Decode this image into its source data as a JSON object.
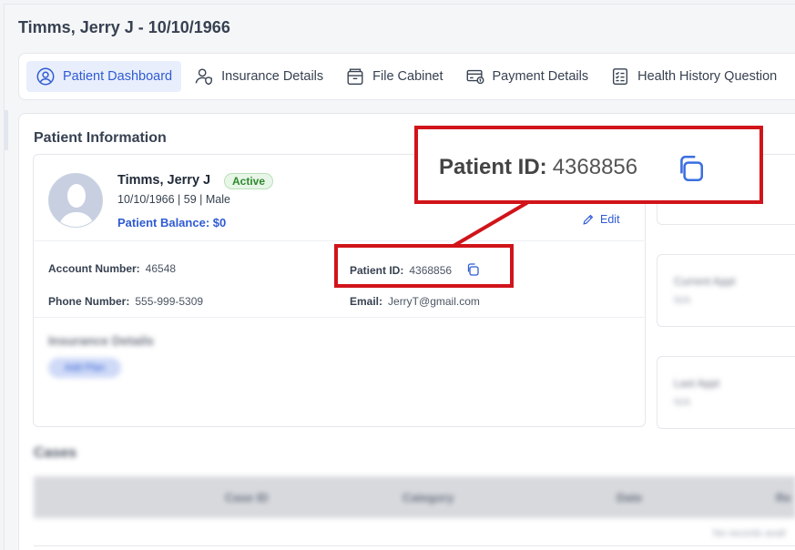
{
  "page": {
    "title": "Timms, Jerry J - 10/10/1966"
  },
  "tabs": [
    {
      "label": "Patient Dashboard",
      "icon": "user-circle-icon",
      "active": true
    },
    {
      "label": "Insurance Details",
      "icon": "user-shield-icon",
      "active": false
    },
    {
      "label": "File Cabinet",
      "icon": "file-cabinet-icon",
      "active": false
    },
    {
      "label": "Payment Details",
      "icon": "payment-card-icon",
      "active": false
    },
    {
      "label": "Health History Question",
      "icon": "checklist-icon",
      "active": false
    }
  ],
  "patient_info": {
    "section_title": "Patient Information",
    "name": "Timms, Jerry J",
    "status": "Active",
    "dob_line": "10/10/1966 | 59 | Male",
    "balance": "Patient Balance: $0",
    "edit_label": "Edit",
    "account_number_label": "Account Number:",
    "account_number": "46548",
    "patient_id_label": "Patient ID:",
    "patient_id": "4368856",
    "phone_label": "Phone Number:",
    "phone": "555-999-5309",
    "email_label": "Email:",
    "email": "JerryT@gmail.com",
    "insurance_title": "Insurance Details",
    "insurance_button": "Add Plan"
  },
  "side_cards": {
    "current_appt_label": "Current Appt",
    "current_appt_value": "N/A",
    "last_appt_label": "Last Appt",
    "last_appt_value": "N/A"
  },
  "cases": {
    "title": "Cases",
    "columns": [
      "Case ID",
      "Category",
      "Date",
      "Re"
    ],
    "empty_text": "No records avail"
  },
  "callout": {
    "label": "Patient ID:",
    "value": "4368856",
    "color": "#d0141a"
  },
  "colors": {
    "accent": "#2f5bd3",
    "active_bg": "#e8eefb",
    "success": "#2d8a2d"
  }
}
